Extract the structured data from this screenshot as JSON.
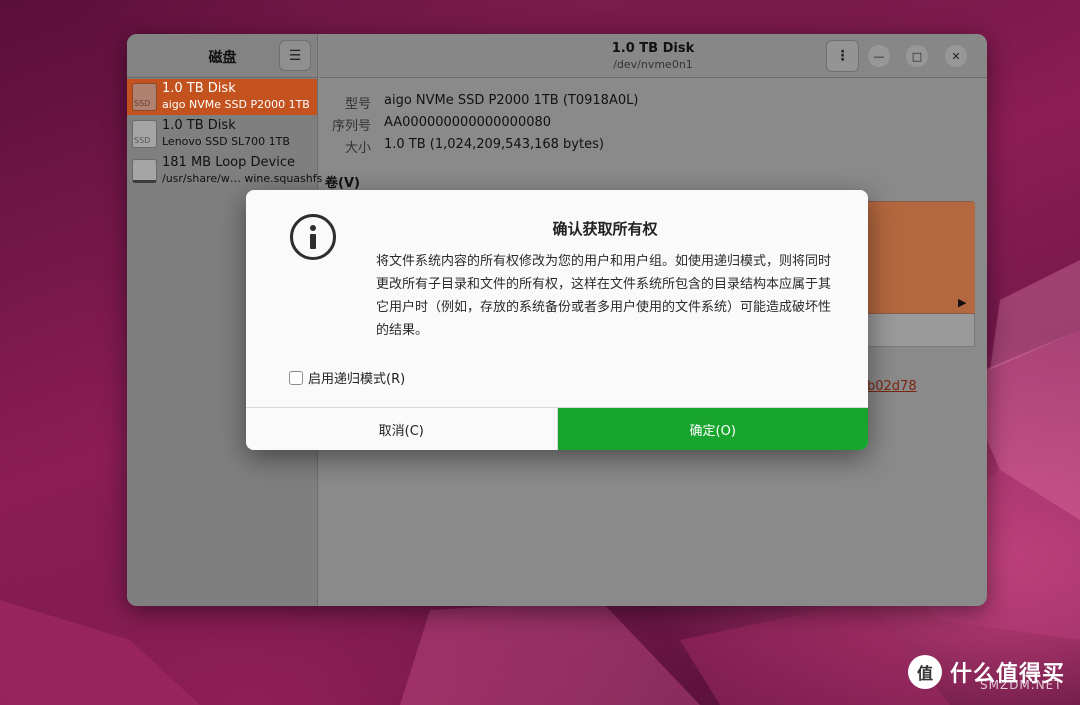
{
  "sidebar": {
    "title": "磁盘",
    "menu_icon": "hamburger-icon",
    "items": [
      {
        "name": "1.0 TB Disk",
        "sub": "aigo NVMe SSD P2000 1TB",
        "icon_label": "SSD",
        "selected": true
      },
      {
        "name": "1.0 TB Disk",
        "sub": "Lenovo SSD SL700 1TB",
        "icon_label": "SSD",
        "selected": false
      },
      {
        "name": "181 MB Loop Device",
        "sub": "/usr/share/w… wine.squashfs",
        "icon_label": "",
        "selected": false
      }
    ]
  },
  "header": {
    "title": "1.0 TB Disk",
    "subtitle": "/dev/nvme0n1",
    "kebab": "⋮",
    "minimize": "—",
    "maximize": "□",
    "close": "✕"
  },
  "info": {
    "model_label": "型号",
    "model_value": "aigo NVMe SSD P2000 1TB (T0918A0L)",
    "serial_label": "序列号",
    "serial_value": "AA000000000000000080",
    "size_label": "大小",
    "size_value": "1.0 TB (1,024,209,543,168 bytes)",
    "volumes_label": "卷(V)",
    "uuid_fragment": "b02d78",
    "play": "▶"
  },
  "dialog": {
    "title": "确认获取所有权",
    "body": "将文件系统内容的所有权修改为您的用户和用户组。如使用递归模式，则将同时更改所有子目录和文件的所有权，这样在文件系统所包含的目录结构本应属于其它用户时（例如，存放的系统备份或者多用户使用的文件系统）可能造成破坏性的结果。",
    "checkbox_label": "启用递归模式(R)",
    "checkbox_checked": false,
    "cancel_label": "取消(C)",
    "ok_label": "确定(O)",
    "ok_color": "#17a52e"
  },
  "watermark": {
    "icon_char": "值",
    "text": "什么值得买",
    "sub": "SMZDM.NET"
  }
}
